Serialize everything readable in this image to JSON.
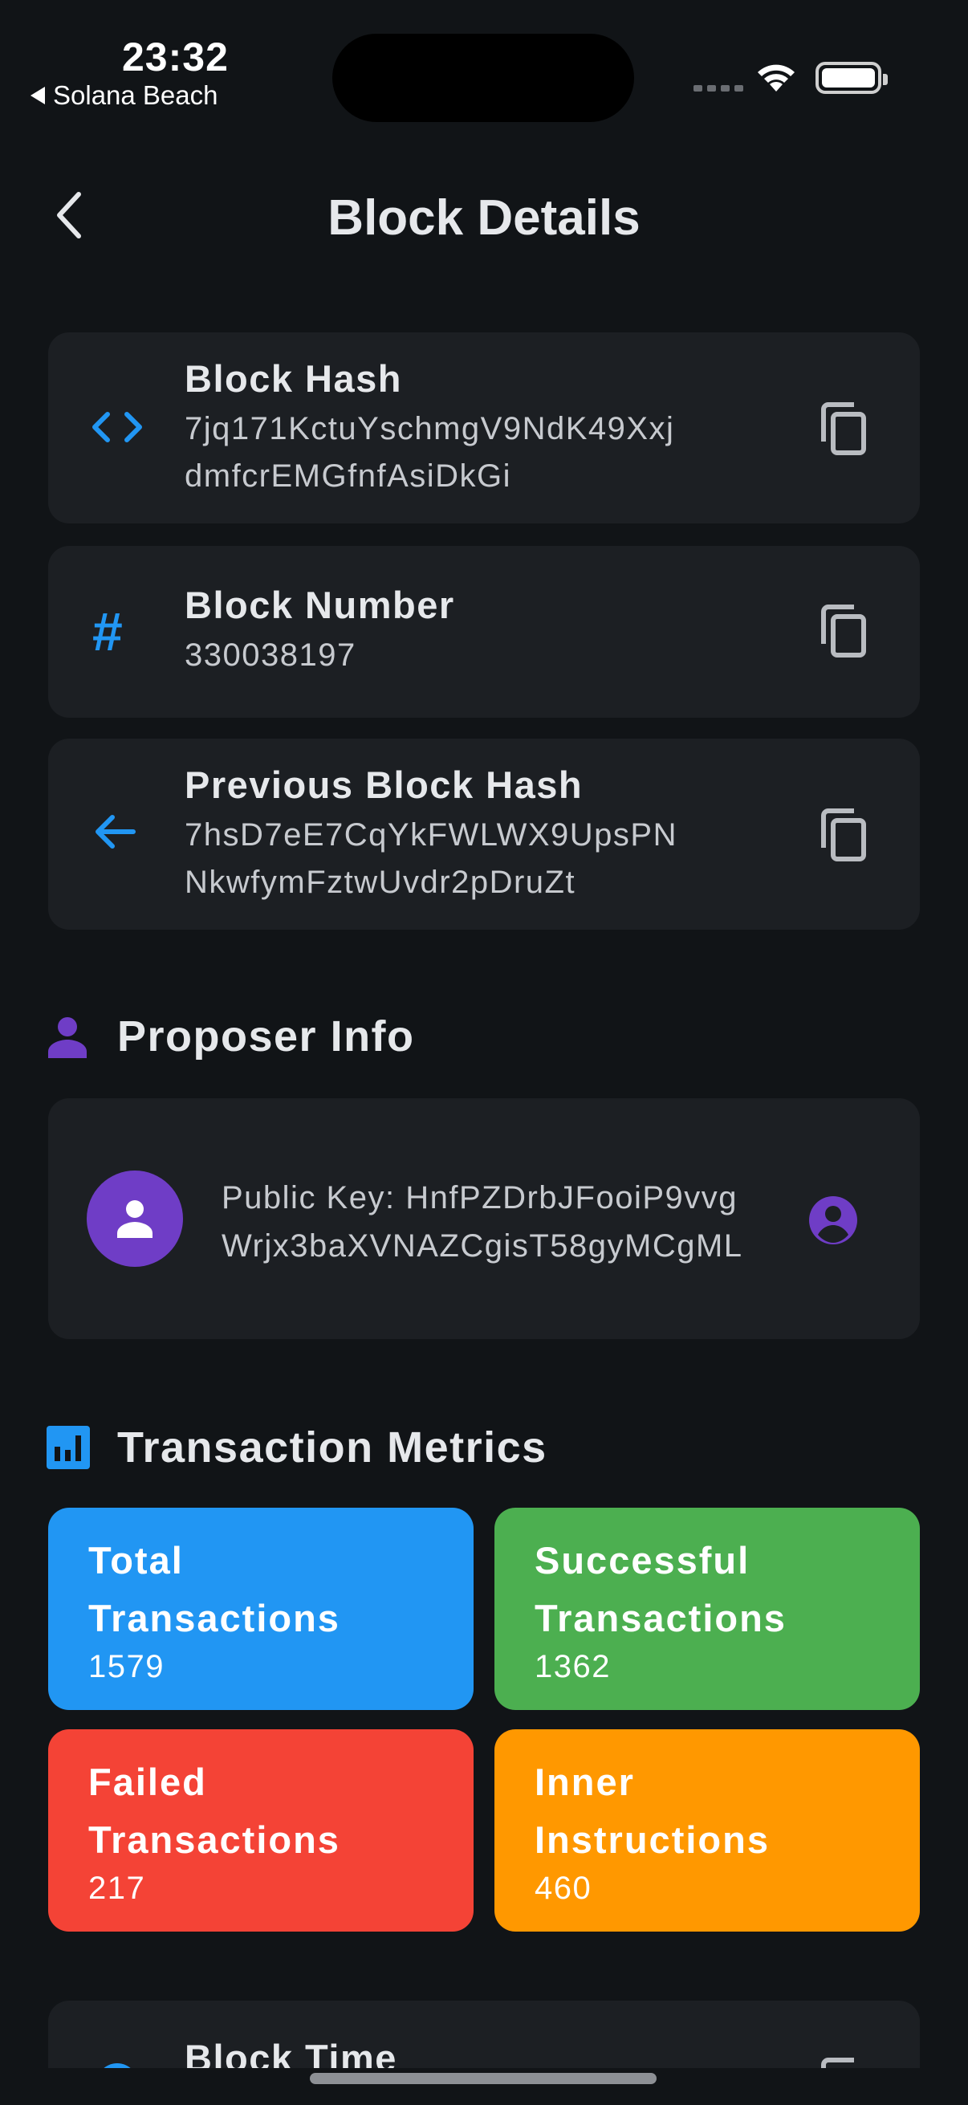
{
  "status_bar": {
    "time": "23:32",
    "back_app": "Solana Beach",
    "icons": [
      "cellular-icon",
      "wifi-icon",
      "battery-icon"
    ]
  },
  "header": {
    "title": "Block Details",
    "back_icon": "chevron-left-icon"
  },
  "details": [
    {
      "label": "Block Hash",
      "value": "7jq171KctuYschmgV9NdK49Xxj dmfcrEMGfnfAsiDkGi",
      "icon": "code-icon"
    },
    {
      "label": "Block Number",
      "value": "330038197",
      "icon": "hash-icon"
    },
    {
      "label": "Previous Block Hash",
      "value": "7hsD7eE7CqYkFWLWX9UpsPN NkwfymFztwUvdr2pDruZt",
      "icon": "arrow-left-icon"
    }
  ],
  "proposer": {
    "section_title": "Proposer Info",
    "public_key_text": "Public Key: HnfPZDrbJFooiP9vvgWrjx3baXVNAZCgisT58gyMCgML"
  },
  "metrics": {
    "section_title": "Transaction Metrics",
    "items": [
      {
        "label": "Total Transactions",
        "value": "1579",
        "color": "#2196f3"
      },
      {
        "label": "Successful Transactions",
        "value": "1362",
        "color": "#4caf50"
      },
      {
        "label": "Failed Transactions",
        "value": "217",
        "color": "#f44336"
      },
      {
        "label": "Inner Instructions",
        "value": "460",
        "color": "#ff9800"
      }
    ]
  },
  "block_time": {
    "label": "Block Time"
  },
  "colors": {
    "background": "#111417",
    "card": "#1c1f23",
    "accent_blue": "#2196f3",
    "accent_purple": "#6f3dc6"
  }
}
